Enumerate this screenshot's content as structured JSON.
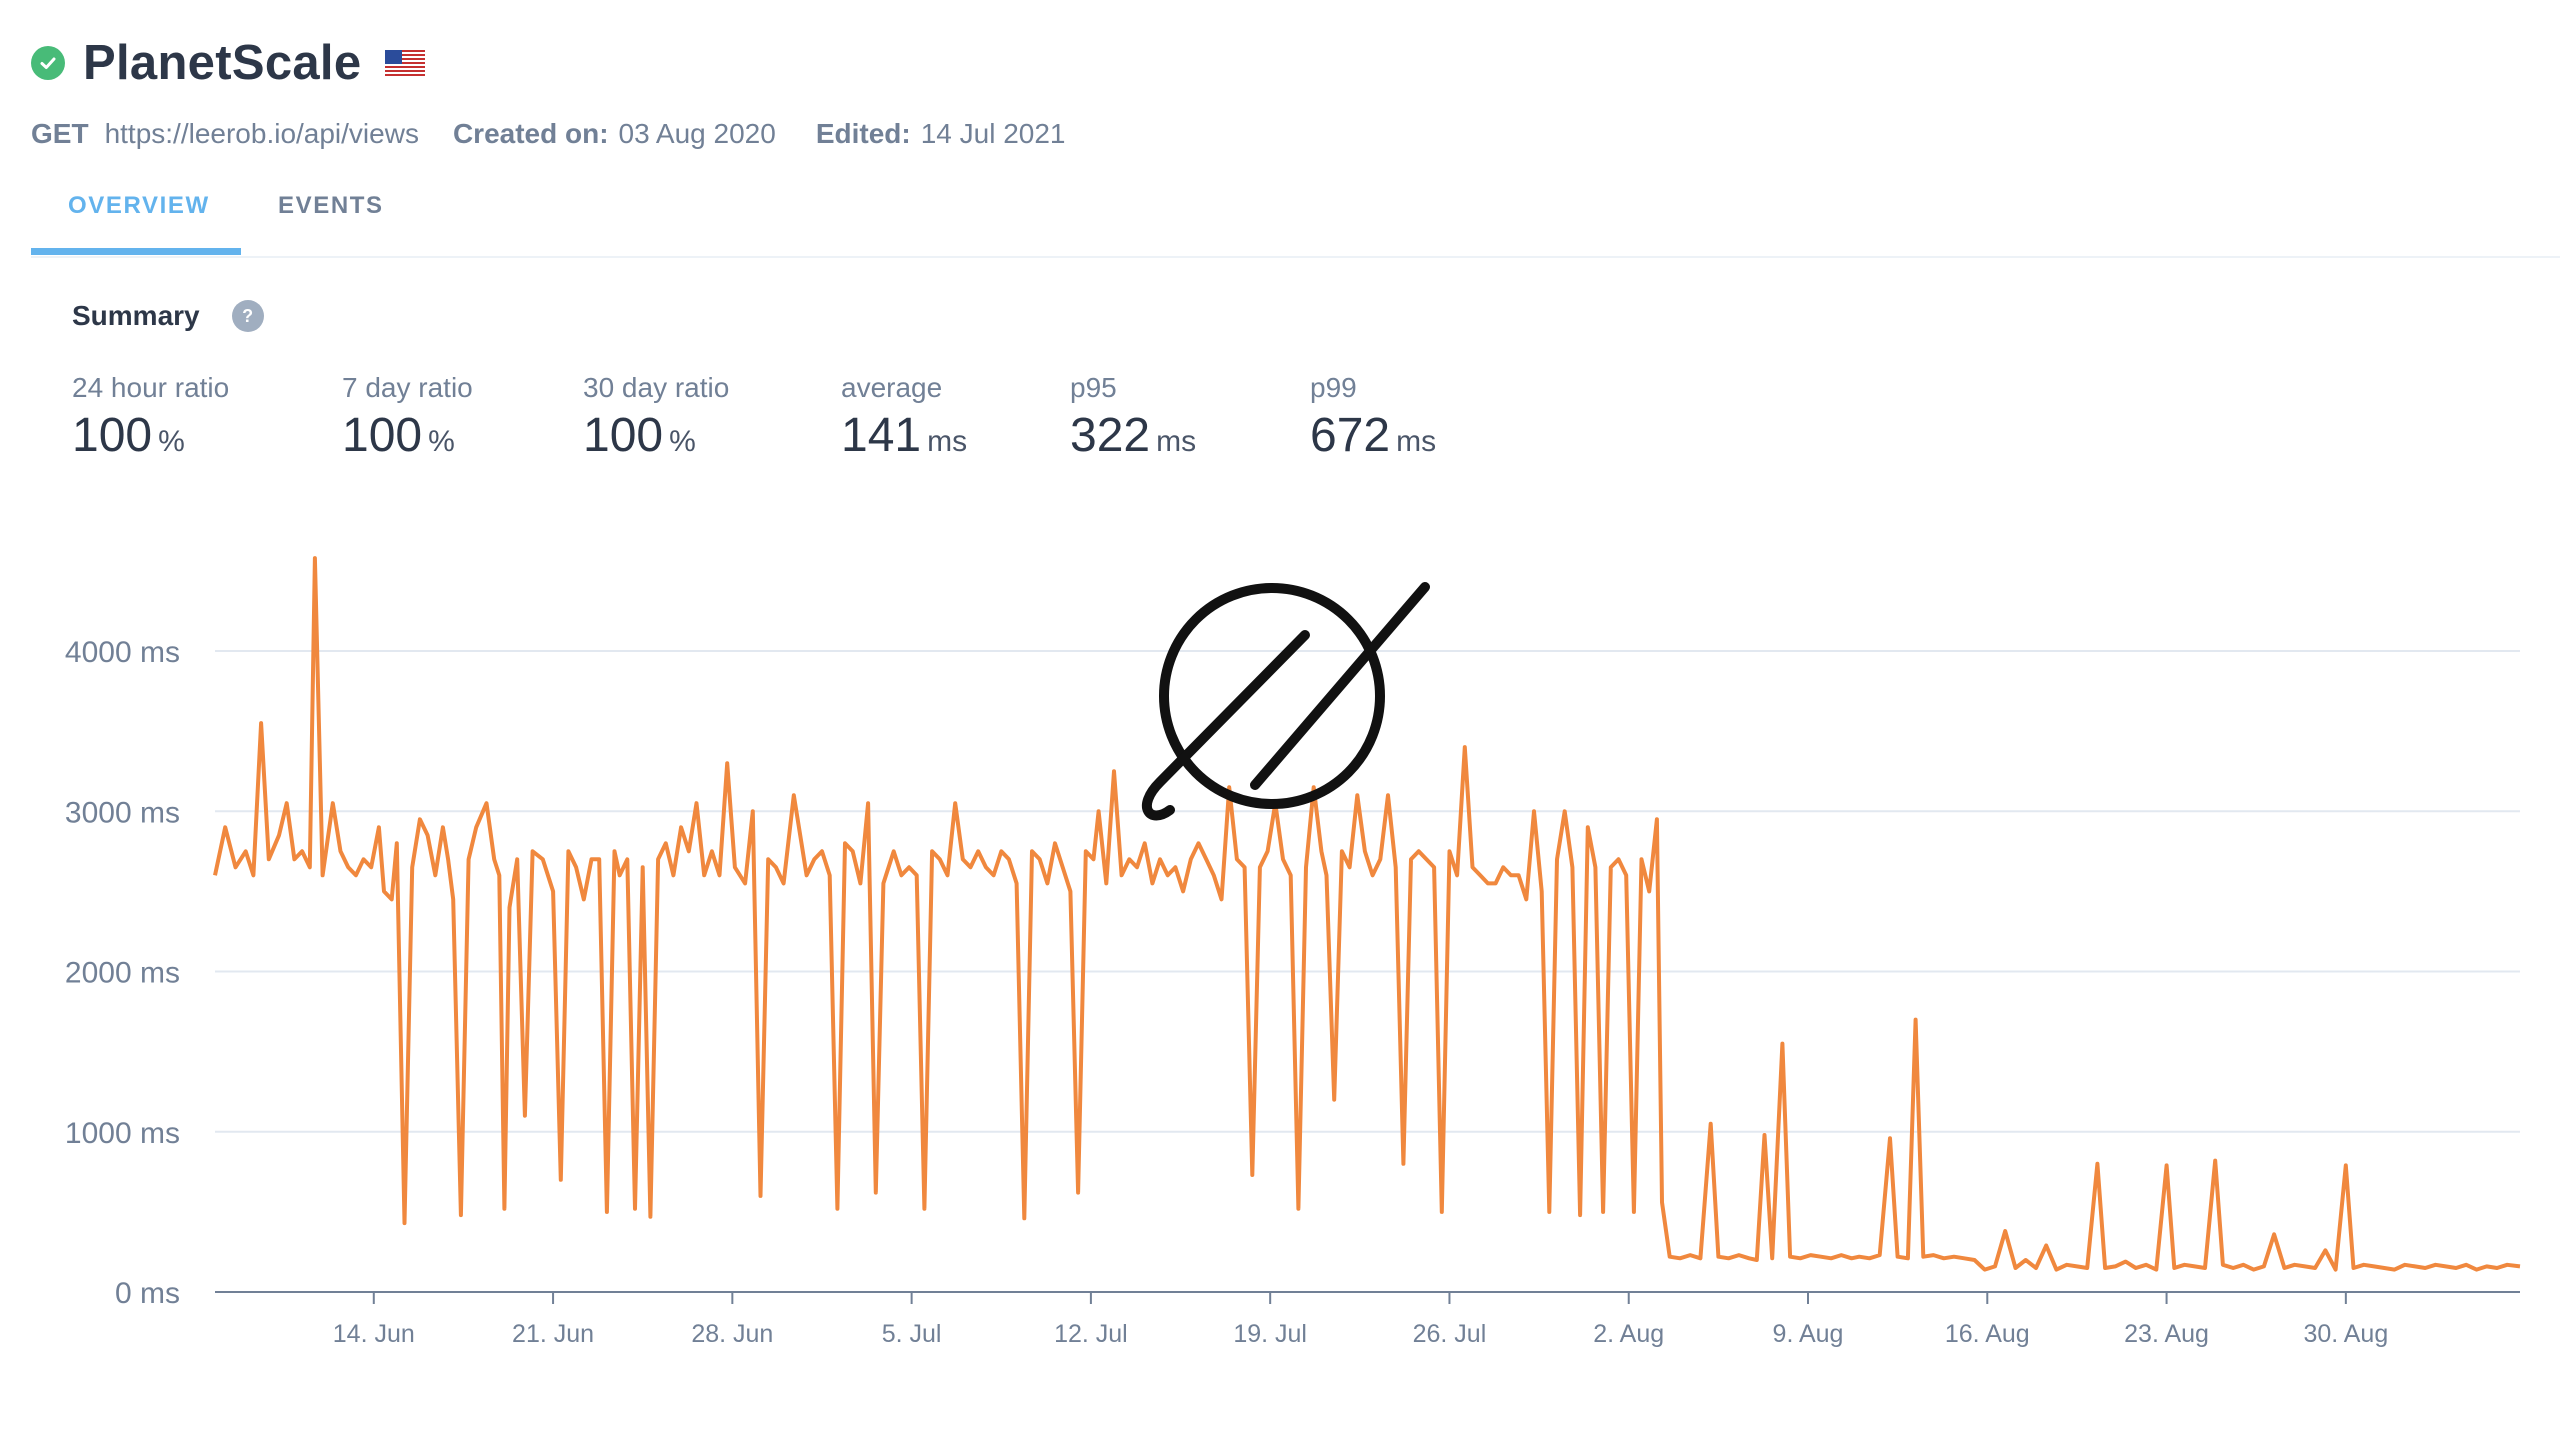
{
  "monitor": {
    "name": "PlanetScale",
    "status": "up",
    "method": "GET",
    "url": "https://leerob.io/api/views",
    "created_label": "Created on:",
    "created_value": "03 Aug 2020",
    "edited_label": "Edited:",
    "edited_value": "14 Jul 2021",
    "region_flag": "us-flag-icon"
  },
  "tabs": [
    {
      "label": "OVERVIEW",
      "active": true
    },
    {
      "label": "EVENTS",
      "active": false
    }
  ],
  "summary": {
    "title": "Summary",
    "help_icon": "?",
    "stats": [
      {
        "label": "24 hour ratio",
        "value": "100",
        "unit": "%"
      },
      {
        "label": "7 day ratio",
        "value": "100",
        "unit": "%"
      },
      {
        "label": "30 day ratio",
        "value": "100",
        "unit": "%"
      },
      {
        "label": "average",
        "value": "141",
        "unit": "ms"
      },
      {
        "label": "p95",
        "value": "322",
        "unit": "ms"
      },
      {
        "label": "p99",
        "value": "672",
        "unit": "ms"
      }
    ]
  },
  "colors": {
    "line": "#f0883e",
    "accent": "#63b3ed",
    "status_ok": "#48bb78",
    "grid": "#e2e8f0"
  },
  "overlay_logo": "planetscale-logo-icon",
  "chart_data": {
    "type": "line",
    "ylabel_unit": "ms",
    "y_ticks": [
      "0 ms",
      "1000 ms",
      "2000 ms",
      "3000 ms",
      "4000 ms"
    ],
    "ylim": [
      0,
      4000
    ],
    "x_ticks": [
      "14. Jun",
      "21. Jun",
      "28. Jun",
      "5. Jul",
      "12. Jul",
      "19. Jul",
      "26. Jul",
      "2. Aug",
      "9. Aug",
      "16. Aug",
      "23. Aug",
      "30. Aug"
    ],
    "x_range_days": [
      -6.2,
      83.8
    ],
    "x_unit": "days since 14. Jun",
    "grid": true,
    "series": [
      {
        "points": [
          [
            -6.2,
            2600
          ],
          [
            -5.8,
            2900
          ],
          [
            -5.4,
            2650
          ],
          [
            -5.0,
            2750
          ],
          [
            -4.7,
            2600
          ],
          [
            -4.4,
            3550
          ],
          [
            -4.1,
            2700
          ],
          [
            -3.7,
            2850
          ],
          [
            -3.4,
            3050
          ],
          [
            -3.1,
            2700
          ],
          [
            -2.8,
            2750
          ],
          [
            -2.5,
            2650
          ],
          [
            -2.3,
            4580
          ],
          [
            -2.0,
            2600
          ],
          [
            -1.6,
            3050
          ],
          [
            -1.3,
            2750
          ],
          [
            -1.0,
            2650
          ],
          [
            -0.7,
            2600
          ],
          [
            -0.4,
            2700
          ],
          [
            -0.1,
            2650
          ],
          [
            0.2,
            2900
          ],
          [
            0.4,
            2500
          ],
          [
            0.7,
            2450
          ],
          [
            0.9,
            2800
          ],
          [
            1.2,
            430
          ],
          [
            1.5,
            2650
          ],
          [
            1.8,
            2950
          ],
          [
            2.1,
            2850
          ],
          [
            2.4,
            2600
          ],
          [
            2.7,
            2900
          ],
          [
            2.9,
            2700
          ],
          [
            3.1,
            2450
          ],
          [
            3.4,
            480
          ],
          [
            3.7,
            2700
          ],
          [
            4.0,
            2900
          ],
          [
            4.4,
            3050
          ],
          [
            4.7,
            2700
          ],
          [
            4.9,
            2600
          ],
          [
            5.1,
            520
          ],
          [
            5.3,
            2400
          ],
          [
            5.6,
            2700
          ],
          [
            5.9,
            1100
          ],
          [
            6.2,
            2750
          ],
          [
            6.6,
            2700
          ],
          [
            7.0,
            2500
          ],
          [
            7.3,
            700
          ],
          [
            7.6,
            2750
          ],
          [
            7.9,
            2650
          ],
          [
            8.2,
            2450
          ],
          [
            8.5,
            2700
          ],
          [
            8.8,
            2700
          ],
          [
            9.1,
            500
          ],
          [
            9.4,
            2750
          ],
          [
            9.6,
            2600
          ],
          [
            9.9,
            2700
          ],
          [
            10.2,
            520
          ],
          [
            10.5,
            2650
          ],
          [
            10.8,
            470
          ],
          [
            11.1,
            2700
          ],
          [
            11.4,
            2800
          ],
          [
            11.7,
            2600
          ],
          [
            12.0,
            2900
          ],
          [
            12.3,
            2750
          ],
          [
            12.6,
            3050
          ],
          [
            12.9,
            2600
          ],
          [
            13.2,
            2750
          ],
          [
            13.5,
            2600
          ],
          [
            13.8,
            3300
          ],
          [
            14.1,
            2650
          ],
          [
            14.5,
            2550
          ],
          [
            14.8,
            3000
          ],
          [
            15.1,
            600
          ],
          [
            15.4,
            2700
          ],
          [
            15.7,
            2650
          ],
          [
            16.0,
            2550
          ],
          [
            16.4,
            3100
          ],
          [
            16.7,
            2800
          ],
          [
            16.9,
            2600
          ],
          [
            17.2,
            2700
          ],
          [
            17.5,
            2750
          ],
          [
            17.8,
            2600
          ],
          [
            18.1,
            520
          ],
          [
            18.4,
            2800
          ],
          [
            18.7,
            2750
          ],
          [
            19.0,
            2550
          ],
          [
            19.3,
            3050
          ],
          [
            19.6,
            620
          ],
          [
            19.9,
            2550
          ],
          [
            20.3,
            2750
          ],
          [
            20.6,
            2600
          ],
          [
            20.9,
            2650
          ],
          [
            21.2,
            2600
          ],
          [
            21.5,
            520
          ],
          [
            21.8,
            2750
          ],
          [
            22.1,
            2700
          ],
          [
            22.4,
            2600
          ],
          [
            22.7,
            3050
          ],
          [
            23.0,
            2700
          ],
          [
            23.3,
            2650
          ],
          [
            23.6,
            2750
          ],
          [
            23.9,
            2650
          ],
          [
            24.2,
            2600
          ],
          [
            24.5,
            2750
          ],
          [
            24.8,
            2700
          ],
          [
            25.1,
            2550
          ],
          [
            25.4,
            460
          ],
          [
            25.7,
            2750
          ],
          [
            26.0,
            2700
          ],
          [
            26.3,
            2550
          ],
          [
            26.6,
            2800
          ],
          [
            26.9,
            2650
          ],
          [
            27.2,
            2500
          ],
          [
            27.5,
            620
          ],
          [
            27.8,
            2750
          ],
          [
            28.1,
            2700
          ],
          [
            28.3,
            3000
          ],
          [
            28.6,
            2550
          ],
          [
            28.9,
            3250
          ],
          [
            29.2,
            2600
          ],
          [
            29.5,
            2700
          ],
          [
            29.8,
            2650
          ],
          [
            30.1,
            2800
          ],
          [
            30.4,
            2550
          ],
          [
            30.7,
            2700
          ],
          [
            31.0,
            2600
          ],
          [
            31.3,
            2650
          ],
          [
            31.6,
            2500
          ],
          [
            31.9,
            2700
          ],
          [
            32.2,
            2800
          ],
          [
            32.5,
            2700
          ],
          [
            32.8,
            2600
          ],
          [
            33.1,
            2450
          ],
          [
            33.4,
            3150
          ],
          [
            33.7,
            2700
          ],
          [
            34.0,
            2650
          ],
          [
            34.3,
            730
          ],
          [
            34.6,
            2650
          ],
          [
            34.9,
            2750
          ],
          [
            35.2,
            3050
          ],
          [
            35.5,
            2700
          ],
          [
            35.8,
            2600
          ],
          [
            36.1,
            520
          ],
          [
            36.4,
            2650
          ],
          [
            36.7,
            3150
          ],
          [
            37.0,
            2750
          ],
          [
            37.2,
            2600
          ],
          [
            37.5,
            1200
          ],
          [
            37.8,
            2750
          ],
          [
            38.1,
            2650
          ],
          [
            38.4,
            3100
          ],
          [
            38.7,
            2750
          ],
          [
            39.0,
            2600
          ],
          [
            39.3,
            2700
          ],
          [
            39.6,
            3100
          ],
          [
            39.9,
            2650
          ],
          [
            40.2,
            800
          ],
          [
            40.5,
            2700
          ],
          [
            40.8,
            2750
          ],
          [
            41.1,
            2700
          ],
          [
            41.4,
            2650
          ],
          [
            41.7,
            500
          ],
          [
            42.0,
            2750
          ],
          [
            42.3,
            2600
          ],
          [
            42.6,
            3400
          ],
          [
            42.9,
            2650
          ],
          [
            43.2,
            2600
          ],
          [
            43.5,
            2550
          ],
          [
            43.8,
            2550
          ],
          [
            44.1,
            2650
          ],
          [
            44.4,
            2600
          ],
          [
            44.7,
            2600
          ],
          [
            45.0,
            2450
          ],
          [
            45.3,
            3000
          ],
          [
            45.6,
            2500
          ],
          [
            45.9,
            500
          ],
          [
            46.2,
            2700
          ],
          [
            46.5,
            3000
          ],
          [
            46.8,
            2650
          ],
          [
            47.1,
            480
          ],
          [
            47.4,
            2900
          ],
          [
            47.7,
            2650
          ],
          [
            48.0,
            500
          ],
          [
            48.3,
            2650
          ],
          [
            48.6,
            2700
          ],
          [
            48.9,
            2600
          ],
          [
            49.2,
            500
          ],
          [
            49.5,
            2700
          ],
          [
            49.8,
            2500
          ],
          [
            50.1,
            2950
          ],
          [
            50.3,
            560
          ],
          [
            50.6,
            220
          ],
          [
            51.0,
            210
          ],
          [
            51.4,
            230
          ],
          [
            51.8,
            210
          ],
          [
            52.2,
            1050
          ],
          [
            52.5,
            220
          ],
          [
            52.9,
            210
          ],
          [
            53.3,
            230
          ],
          [
            53.7,
            210
          ],
          [
            54.0,
            200
          ],
          [
            54.3,
            980
          ],
          [
            54.6,
            210
          ],
          [
            55.0,
            1550
          ],
          [
            55.3,
            220
          ],
          [
            55.7,
            210
          ],
          [
            56.1,
            230
          ],
          [
            56.5,
            220
          ],
          [
            56.9,
            210
          ],
          [
            57.3,
            230
          ],
          [
            57.7,
            210
          ],
          [
            58.0,
            220
          ],
          [
            58.4,
            210
          ],
          [
            58.8,
            230
          ],
          [
            59.2,
            960
          ],
          [
            59.5,
            220
          ],
          [
            59.9,
            210
          ],
          [
            60.2,
            1700
          ],
          [
            60.5,
            220
          ],
          [
            60.9,
            230
          ],
          [
            61.3,
            210
          ],
          [
            61.7,
            220
          ],
          [
            62.1,
            210
          ],
          [
            62.5,
            200
          ],
          [
            62.9,
            140
          ],
          [
            63.3,
            160
          ],
          [
            63.7,
            380
          ],
          [
            64.1,
            150
          ],
          [
            64.5,
            200
          ],
          [
            64.9,
            150
          ],
          [
            65.3,
            290
          ],
          [
            65.7,
            140
          ],
          [
            66.1,
            170
          ],
          [
            66.5,
            160
          ],
          [
            66.9,
            150
          ],
          [
            67.3,
            800
          ],
          [
            67.6,
            150
          ],
          [
            68.0,
            160
          ],
          [
            68.4,
            190
          ],
          [
            68.8,
            150
          ],
          [
            69.2,
            170
          ],
          [
            69.6,
            140
          ],
          [
            70.0,
            790
          ],
          [
            70.3,
            150
          ],
          [
            70.7,
            170
          ],
          [
            71.1,
            160
          ],
          [
            71.5,
            150
          ],
          [
            71.9,
            820
          ],
          [
            72.2,
            170
          ],
          [
            72.6,
            150
          ],
          [
            73.0,
            170
          ],
          [
            73.4,
            140
          ],
          [
            73.8,
            160
          ],
          [
            74.2,
            360
          ],
          [
            74.6,
            150
          ],
          [
            75.0,
            170
          ],
          [
            75.4,
            160
          ],
          [
            75.8,
            150
          ],
          [
            76.2,
            260
          ],
          [
            76.6,
            140
          ],
          [
            77.0,
            790
          ],
          [
            77.3,
            150
          ],
          [
            77.7,
            170
          ],
          [
            78.1,
            160
          ],
          [
            78.5,
            150
          ],
          [
            78.9,
            140
          ],
          [
            79.3,
            170
          ],
          [
            79.7,
            160
          ],
          [
            80.1,
            150
          ],
          [
            80.5,
            170
          ],
          [
            80.9,
            160
          ],
          [
            81.3,
            150
          ],
          [
            81.7,
            170
          ],
          [
            82.1,
            140
          ],
          [
            82.5,
            160
          ],
          [
            82.9,
            150
          ],
          [
            83.3,
            170
          ],
          [
            83.8,
            160
          ]
        ]
      }
    ]
  }
}
